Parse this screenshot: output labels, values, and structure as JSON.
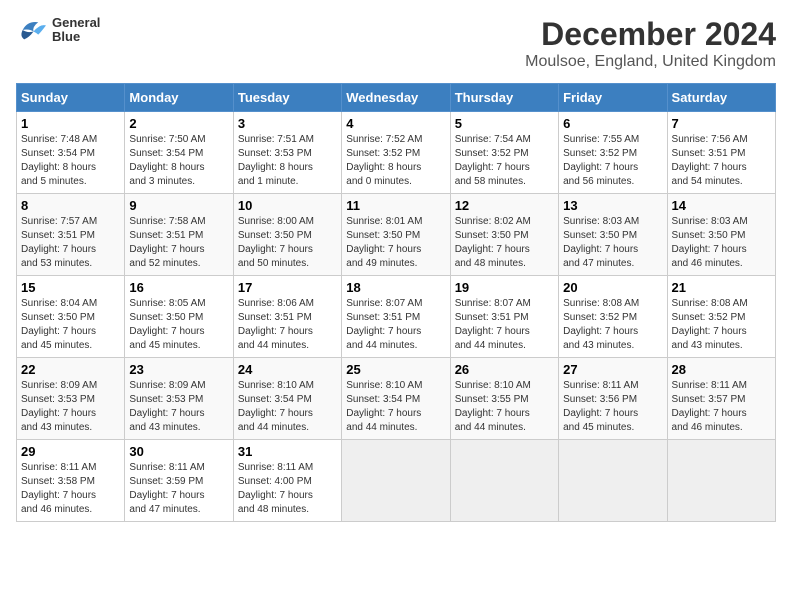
{
  "header": {
    "logo_line1": "General",
    "logo_line2": "Blue",
    "main_title": "December 2024",
    "subtitle": "Moulsoe, England, United Kingdom"
  },
  "columns": [
    "Sunday",
    "Monday",
    "Tuesday",
    "Wednesday",
    "Thursday",
    "Friday",
    "Saturday"
  ],
  "weeks": [
    [
      {
        "day": "1",
        "info": "Sunrise: 7:48 AM\nSunset: 3:54 PM\nDaylight: 8 hours\nand 5 minutes."
      },
      {
        "day": "2",
        "info": "Sunrise: 7:50 AM\nSunset: 3:54 PM\nDaylight: 8 hours\nand 3 minutes."
      },
      {
        "day": "3",
        "info": "Sunrise: 7:51 AM\nSunset: 3:53 PM\nDaylight: 8 hours\nand 1 minute."
      },
      {
        "day": "4",
        "info": "Sunrise: 7:52 AM\nSunset: 3:52 PM\nDaylight: 8 hours\nand 0 minutes."
      },
      {
        "day": "5",
        "info": "Sunrise: 7:54 AM\nSunset: 3:52 PM\nDaylight: 7 hours\nand 58 minutes."
      },
      {
        "day": "6",
        "info": "Sunrise: 7:55 AM\nSunset: 3:52 PM\nDaylight: 7 hours\nand 56 minutes."
      },
      {
        "day": "7",
        "info": "Sunrise: 7:56 AM\nSunset: 3:51 PM\nDaylight: 7 hours\nand 54 minutes."
      }
    ],
    [
      {
        "day": "8",
        "info": "Sunrise: 7:57 AM\nSunset: 3:51 PM\nDaylight: 7 hours\nand 53 minutes."
      },
      {
        "day": "9",
        "info": "Sunrise: 7:58 AM\nSunset: 3:51 PM\nDaylight: 7 hours\nand 52 minutes."
      },
      {
        "day": "10",
        "info": "Sunrise: 8:00 AM\nSunset: 3:50 PM\nDaylight: 7 hours\nand 50 minutes."
      },
      {
        "day": "11",
        "info": "Sunrise: 8:01 AM\nSunset: 3:50 PM\nDaylight: 7 hours\nand 49 minutes."
      },
      {
        "day": "12",
        "info": "Sunrise: 8:02 AM\nSunset: 3:50 PM\nDaylight: 7 hours\nand 48 minutes."
      },
      {
        "day": "13",
        "info": "Sunrise: 8:03 AM\nSunset: 3:50 PM\nDaylight: 7 hours\nand 47 minutes."
      },
      {
        "day": "14",
        "info": "Sunrise: 8:03 AM\nSunset: 3:50 PM\nDaylight: 7 hours\nand 46 minutes."
      }
    ],
    [
      {
        "day": "15",
        "info": "Sunrise: 8:04 AM\nSunset: 3:50 PM\nDaylight: 7 hours\nand 45 minutes."
      },
      {
        "day": "16",
        "info": "Sunrise: 8:05 AM\nSunset: 3:50 PM\nDaylight: 7 hours\nand 45 minutes."
      },
      {
        "day": "17",
        "info": "Sunrise: 8:06 AM\nSunset: 3:51 PM\nDaylight: 7 hours\nand 44 minutes."
      },
      {
        "day": "18",
        "info": "Sunrise: 8:07 AM\nSunset: 3:51 PM\nDaylight: 7 hours\nand 44 minutes."
      },
      {
        "day": "19",
        "info": "Sunrise: 8:07 AM\nSunset: 3:51 PM\nDaylight: 7 hours\nand 44 minutes."
      },
      {
        "day": "20",
        "info": "Sunrise: 8:08 AM\nSunset: 3:52 PM\nDaylight: 7 hours\nand 43 minutes."
      },
      {
        "day": "21",
        "info": "Sunrise: 8:08 AM\nSunset: 3:52 PM\nDaylight: 7 hours\nand 43 minutes."
      }
    ],
    [
      {
        "day": "22",
        "info": "Sunrise: 8:09 AM\nSunset: 3:53 PM\nDaylight: 7 hours\nand 43 minutes."
      },
      {
        "day": "23",
        "info": "Sunrise: 8:09 AM\nSunset: 3:53 PM\nDaylight: 7 hours\nand 43 minutes."
      },
      {
        "day": "24",
        "info": "Sunrise: 8:10 AM\nSunset: 3:54 PM\nDaylight: 7 hours\nand 44 minutes."
      },
      {
        "day": "25",
        "info": "Sunrise: 8:10 AM\nSunset: 3:54 PM\nDaylight: 7 hours\nand 44 minutes."
      },
      {
        "day": "26",
        "info": "Sunrise: 8:10 AM\nSunset: 3:55 PM\nDaylight: 7 hours\nand 44 minutes."
      },
      {
        "day": "27",
        "info": "Sunrise: 8:11 AM\nSunset: 3:56 PM\nDaylight: 7 hours\nand 45 minutes."
      },
      {
        "day": "28",
        "info": "Sunrise: 8:11 AM\nSunset: 3:57 PM\nDaylight: 7 hours\nand 46 minutes."
      }
    ],
    [
      {
        "day": "29",
        "info": "Sunrise: 8:11 AM\nSunset: 3:58 PM\nDaylight: 7 hours\nand 46 minutes."
      },
      {
        "day": "30",
        "info": "Sunrise: 8:11 AM\nSunset: 3:59 PM\nDaylight: 7 hours\nand 47 minutes."
      },
      {
        "day": "31",
        "info": "Sunrise: 8:11 AM\nSunset: 4:00 PM\nDaylight: 7 hours\nand 48 minutes."
      },
      null,
      null,
      null,
      null
    ]
  ]
}
